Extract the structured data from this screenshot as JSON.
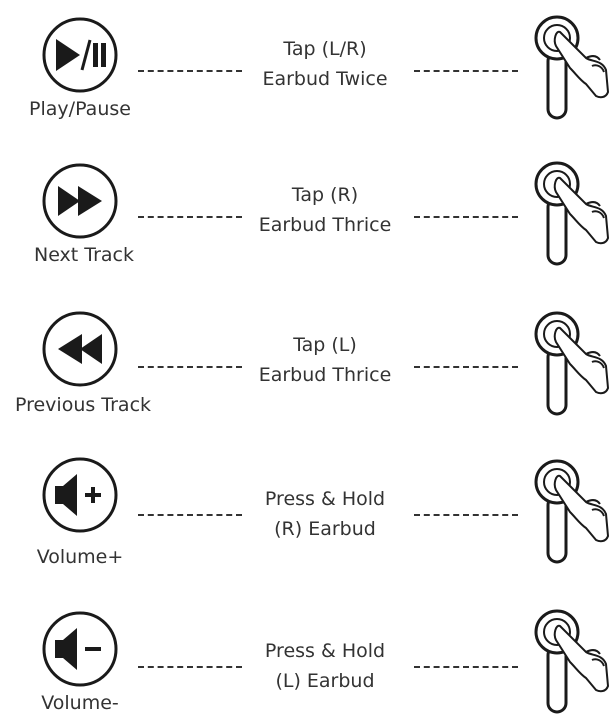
{
  "controls": [
    {
      "icon": "play-pause-icon",
      "label": "Play/Pause",
      "action_line1": "Tap (L/R)",
      "action_line2": "Earbud Twice"
    },
    {
      "icon": "next-track-icon",
      "label": "Next Track",
      "action_line1": "Tap (R)",
      "action_line2": "Earbud Thrice"
    },
    {
      "icon": "previous-track-icon",
      "label": "Previous Track",
      "action_line1": "Tap (L)",
      "action_line2": "Earbud Thrice"
    },
    {
      "icon": "volume-up-icon",
      "label": "Volume+",
      "action_line1": "Press & Hold",
      "action_line2": "(R) Earbud"
    },
    {
      "icon": "volume-down-icon",
      "label": "Volume-",
      "action_line1": "Press & Hold",
      "action_line2": "(L) Earbud"
    }
  ],
  "colors": {
    "ink": "#1a1a1a",
    "text": "#333333",
    "background": "#ffffff"
  }
}
